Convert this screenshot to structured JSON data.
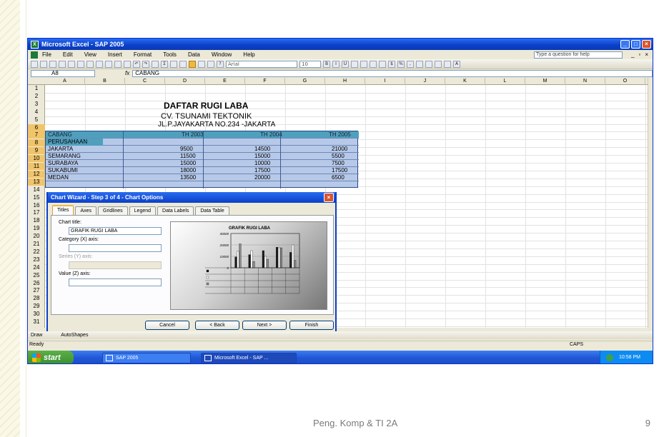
{
  "window": {
    "title": "Microsoft Excel - SAP 2005",
    "min_icon": "minimize-icon",
    "max_icon": "maximize-icon",
    "close_icon": "close-icon"
  },
  "menu": {
    "items": [
      "File",
      "Edit",
      "View",
      "Insert",
      "Format",
      "Tools",
      "Data",
      "Window",
      "Help"
    ],
    "help_placeholder": "Type a question for help"
  },
  "toolbar": {
    "font": "Arial",
    "size": "10"
  },
  "formula": {
    "name_box": "A8",
    "fx": "fx",
    "value": "CABANG"
  },
  "columns": [
    "A",
    "B",
    "C",
    "D",
    "E",
    "F",
    "G",
    "H",
    "I",
    "J",
    "K",
    "L",
    "M",
    "N",
    "O"
  ],
  "rows": [
    "1",
    "2",
    "3",
    "4",
    "5",
    "6",
    "7",
    "8",
    "9",
    "10",
    "11",
    "12",
    "13",
    "14",
    "15",
    "16",
    "17",
    "18",
    "19",
    "20",
    "21",
    "22",
    "23",
    "24",
    "25",
    "26",
    "27",
    "28",
    "29",
    "30",
    "31"
  ],
  "sheet": {
    "title": "DAFTAR RUGI LABA",
    "company": "CV. TSUNAMI TEKTONIK",
    "address": "JL.P.JAYAKARTA NO.234 -JAKARTA",
    "header_cabang": "CABANG",
    "header_perusahaan": "PERUSAHAAN",
    "year_headers": [
      "TH 2003",
      "TH 2004",
      "TH 2005"
    ],
    "rows": [
      {
        "name": "JAKARTA",
        "v": [
          "9500",
          "14500",
          "21000"
        ]
      },
      {
        "name": "SEMARANG",
        "v": [
          "11500",
          "15000",
          "5500"
        ]
      },
      {
        "name": "SURABAYA",
        "v": [
          "15000",
          "10000",
          "7500"
        ]
      },
      {
        "name": "SUKABUMI",
        "v": [
          "18000",
          "17500",
          "17500"
        ]
      },
      {
        "name": "MEDAN",
        "v": [
          "13500",
          "20000",
          "6500"
        ]
      }
    ]
  },
  "dialog": {
    "title": "Chart Wizard - Step 3 of 4 - Chart Options",
    "tabs": [
      "Titles",
      "Axes",
      "Gridlines",
      "Legend",
      "Data Labels",
      "Data Table"
    ],
    "chart_title_label": "Chart title:",
    "chart_title_value": "GRAFIK RUGI LABA",
    "category_label": "Category (X) axis:",
    "series_label": "Series (Y) axis:",
    "value_label": "Value (Z) axis:",
    "preview_title": "GRAFIK RUGI LABA",
    "preview_ticks": [
      "30000",
      "20000",
      "10000",
      "0"
    ],
    "buttons": {
      "cancel": "Cancel",
      "back": "< Back",
      "next": "Next >",
      "finish": "Finish"
    }
  },
  "drawbar": {
    "draw": "Draw",
    "autoshapes": "AutoShapes"
  },
  "status": {
    "ready": "Ready",
    "caps": "CAPS"
  },
  "taskbar": {
    "start": "start",
    "tasks": [
      "SAP 2005",
      "Microsoft Excel - SAP ..."
    ],
    "clock": "10:58 PM"
  },
  "slide": {
    "footer": "Peng. Komp & TI 2A",
    "page": "9"
  },
  "chart_data": {
    "type": "bar",
    "title": "GRAFIK RUGI LABA",
    "categories": [
      "JAKARTA",
      "SEMARANG",
      "SURABAYA",
      "SUKABUMI",
      "MEDAN"
    ],
    "series": [
      {
        "name": "TH 2003",
        "values": [
          9500,
          11500,
          15000,
          18000,
          13500
        ]
      },
      {
        "name": "TH 2004",
        "values": [
          14500,
          15000,
          10000,
          17500,
          20000
        ]
      },
      {
        "name": "TH 2005",
        "values": [
          21000,
          5500,
          7500,
          17500,
          6500
        ]
      }
    ],
    "ylim": [
      0,
      30000
    ],
    "colors": [
      "#1a1a1a",
      "#ffffff",
      "#8a8a8a"
    ]
  }
}
